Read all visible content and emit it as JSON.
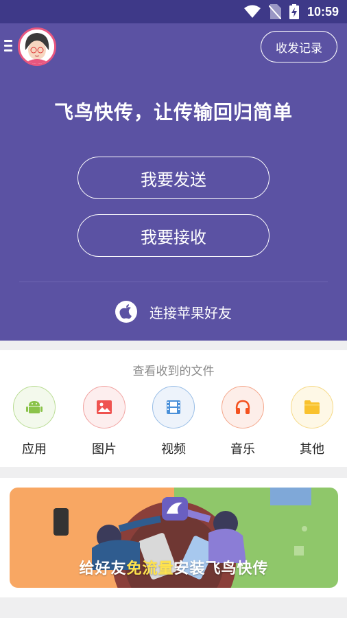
{
  "statusbar": {
    "time": "10:59"
  },
  "header": {
    "history_label": "收发记录"
  },
  "hero": {
    "slogan": "飞鸟快传，让传输回归简单",
    "send_label": "我要发送",
    "receive_label": "我要接收",
    "apple_label": "连接苹果好友"
  },
  "files": {
    "title": "查看收到的文件",
    "categories": [
      {
        "label": "应用",
        "icon": "android-icon",
        "color": "#8bc34a"
      },
      {
        "label": "图片",
        "icon": "image-icon",
        "color": "#ef5350"
      },
      {
        "label": "视频",
        "icon": "film-icon",
        "color": "#4a90d9"
      },
      {
        "label": "音乐",
        "icon": "headphones-icon",
        "color": "#f4511e"
      },
      {
        "label": "其他",
        "icon": "folder-icon",
        "color": "#f9c22e"
      }
    ]
  },
  "banner": {
    "text_before": "给好友",
    "text_highlight": "免流量",
    "text_after": "安装飞鸟快传"
  },
  "colors": {
    "hero_bg": "#5b52a3",
    "statusbar_bg": "#3e3988"
  }
}
